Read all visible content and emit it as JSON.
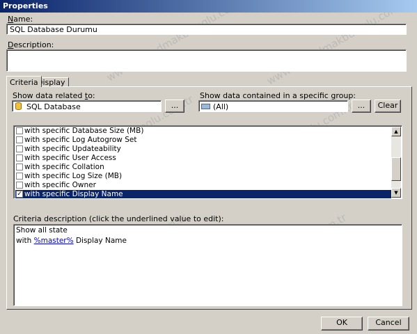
{
  "window": {
    "title": "Properties"
  },
  "name_field": {
    "label_u": "N",
    "label_rest": "ame:",
    "value": "SQL Database Durumu"
  },
  "description_field": {
    "label_u": "D",
    "label_rest": "escription:",
    "value": ""
  },
  "tabs": [
    {
      "label": "Criteria"
    },
    {
      "label": "Display"
    }
  ],
  "related": {
    "label_prefix": "Show data related ",
    "label_u": "t",
    "label_rest": "o:",
    "value": "SQL Database",
    "browse": "..."
  },
  "group": {
    "label_prefix": "Show data contained in a specific ",
    "label_u": "g",
    "label_rest": "roup:",
    "value": "(All)",
    "browse": "...",
    "clear": "Clear"
  },
  "criteria_list": [
    {
      "text": "with specific Database Size (MB)",
      "checked": false,
      "selected": false
    },
    {
      "text": "with specific Log Autogrow Set",
      "checked": false,
      "selected": false
    },
    {
      "text": "with specific Updateability",
      "checked": false,
      "selected": false
    },
    {
      "text": "with specific User Access",
      "checked": false,
      "selected": false
    },
    {
      "text": "with specific Collation",
      "checked": false,
      "selected": false
    },
    {
      "text": "with specific Log Size (MB)",
      "checked": false,
      "selected": false
    },
    {
      "text": "with specific Owner",
      "checked": false,
      "selected": false
    },
    {
      "text": "with specific Display Name",
      "checked": true,
      "selected": true
    }
  ],
  "criteria_description": {
    "label": "Criteria description (click the underlined value to edit):",
    "line1": "Show all state",
    "line2_prefix": "with ",
    "line2_link": "%master%",
    "line2_suffix": " Display Name"
  },
  "buttons": {
    "ok": "OK",
    "cancel": "Cancel"
  },
  "watermark": "www.serhadmakbuloglu.com.tr"
}
